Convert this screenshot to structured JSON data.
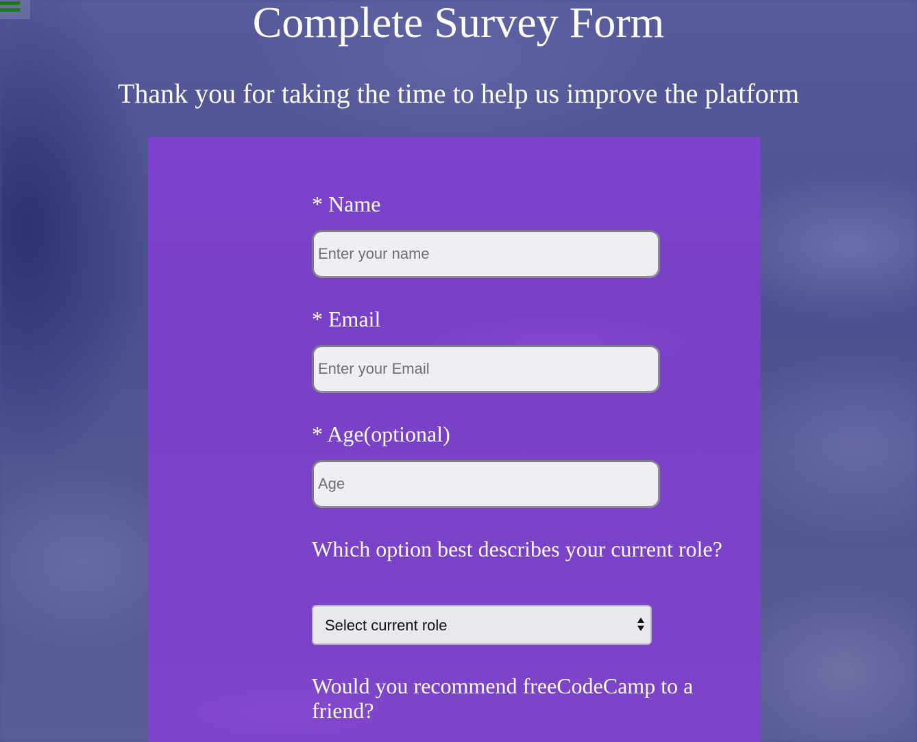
{
  "page": {
    "title": "Complete Survey Form",
    "subtitle": "Thank you for taking the time to help us improve the platform"
  },
  "nav": {
    "menu_icon": "hamburger-menu-icon"
  },
  "form": {
    "name": {
      "label": "* Name",
      "placeholder": "Enter your name",
      "value": ""
    },
    "email": {
      "label": "* Email",
      "placeholder": "Enter your Email",
      "value": ""
    },
    "age": {
      "label": "* Age(optional)",
      "placeholder": "Age",
      "value": ""
    },
    "role": {
      "question": "Which option best describes your current role?",
      "selected": "Select current role",
      "arrow_icon": "select-updown-arrows-icon"
    },
    "recommend": {
      "question": "Would you recommend freeCodeCamp to a friend?"
    }
  },
  "colors": {
    "card": "#7a42c8",
    "background": "#4c4f8e",
    "menu_bars": "#1b7a1b",
    "text": "#ffffff"
  }
}
